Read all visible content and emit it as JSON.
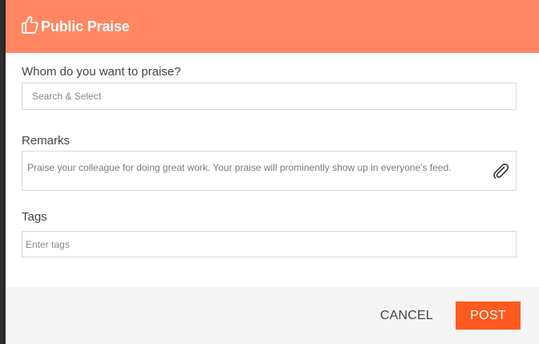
{
  "dialog": {
    "title": "Public Praise",
    "header_color": "#ff8660",
    "header_icon": "thumbs-up-icon"
  },
  "whom": {
    "label": "Whom do you want to praise?",
    "placeholder": "Search & Select"
  },
  "remarks": {
    "label": "Remarks",
    "placeholder": "Praise your colleague for doing great work. Your praise will prominently show up in everyone's feed.",
    "attach_icon": "paperclip-icon"
  },
  "tags": {
    "label": "Tags",
    "placeholder": "Enter tags"
  },
  "footer": {
    "cancel_label": "CANCEL",
    "post_label": "POST",
    "post_color": "#ff5a1f"
  }
}
